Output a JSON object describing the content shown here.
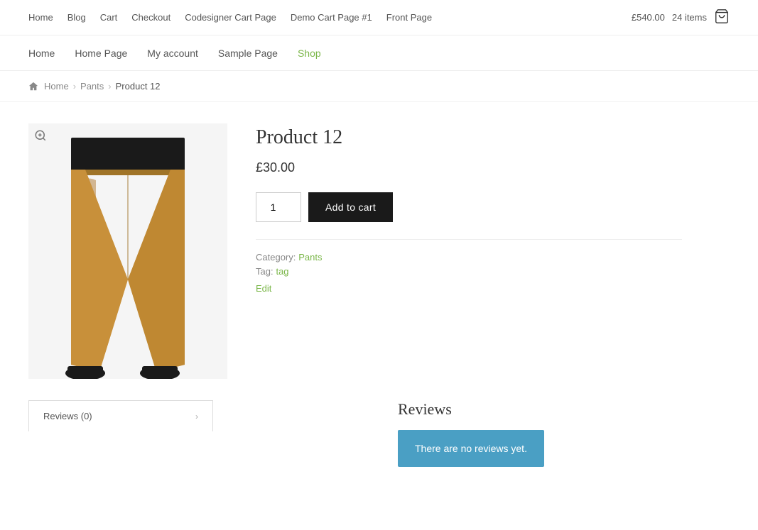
{
  "top_nav": {
    "links": [
      {
        "label": "Home",
        "href": "#"
      },
      {
        "label": "Blog",
        "href": "#"
      },
      {
        "label": "Cart",
        "href": "#"
      },
      {
        "label": "Checkout",
        "href": "#"
      },
      {
        "label": "Codesigner Cart Page",
        "href": "#"
      },
      {
        "label": "Demo Cart Page #1",
        "href": "#"
      },
      {
        "label": "Front Page",
        "href": "#"
      }
    ],
    "cart_total": "£540.00",
    "cart_items": "24 items"
  },
  "main_nav": {
    "links": [
      {
        "label": "Home",
        "active": false
      },
      {
        "label": "Home Page",
        "active": false
      },
      {
        "label": "My account",
        "active": false
      },
      {
        "label": "Sample Page",
        "active": false
      },
      {
        "label": "Shop",
        "active": false
      }
    ]
  },
  "breadcrumb": {
    "home": "Home",
    "category": "Pants",
    "current": "Product 12"
  },
  "product": {
    "title": "Product 12",
    "price": "£30.00",
    "quantity": "1",
    "add_to_cart_label": "Add to cart",
    "category_label": "Category:",
    "category_value": "Pants",
    "tag_label": "Tag:",
    "tag_value": "tag",
    "edit_label": "Edit"
  },
  "reviews": {
    "tab_label": "Reviews (0)",
    "title": "Reviews",
    "no_reviews_text": "There are no reviews yet."
  }
}
